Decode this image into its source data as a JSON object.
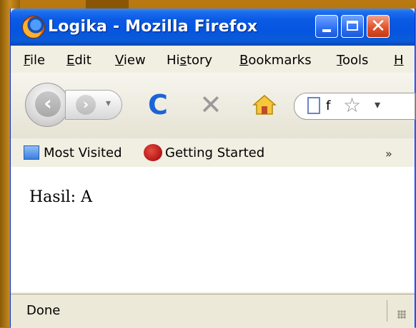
{
  "window": {
    "title": "Logika - Mozilla Firefox",
    "controls": {
      "minimize": "_",
      "maximize": "□",
      "close": "✕"
    }
  },
  "menu": {
    "items": [
      {
        "label": "File"
      },
      {
        "label": "Edit"
      },
      {
        "label": "View"
      },
      {
        "label": "History"
      },
      {
        "label": "Bookmarks"
      },
      {
        "label": "Tools"
      },
      {
        "label": "H"
      }
    ]
  },
  "toolbar": {
    "back": "‹",
    "forward": "›",
    "forward_dropdown": "▾",
    "reload": "C",
    "stop": "✕",
    "url_text": "f",
    "star": "☆",
    "url_dropdown": "▾"
  },
  "bookmarks": {
    "items": [
      {
        "label": "Most Visited"
      },
      {
        "label": "Getting Started"
      }
    ],
    "overflow": "»"
  },
  "content": {
    "text": "Hasil: A"
  },
  "status": {
    "text": "Done"
  },
  "colors": {
    "titlebar": "#0a5ae4",
    "reload": "#1b63d9",
    "desktop": "#a86a0a"
  }
}
